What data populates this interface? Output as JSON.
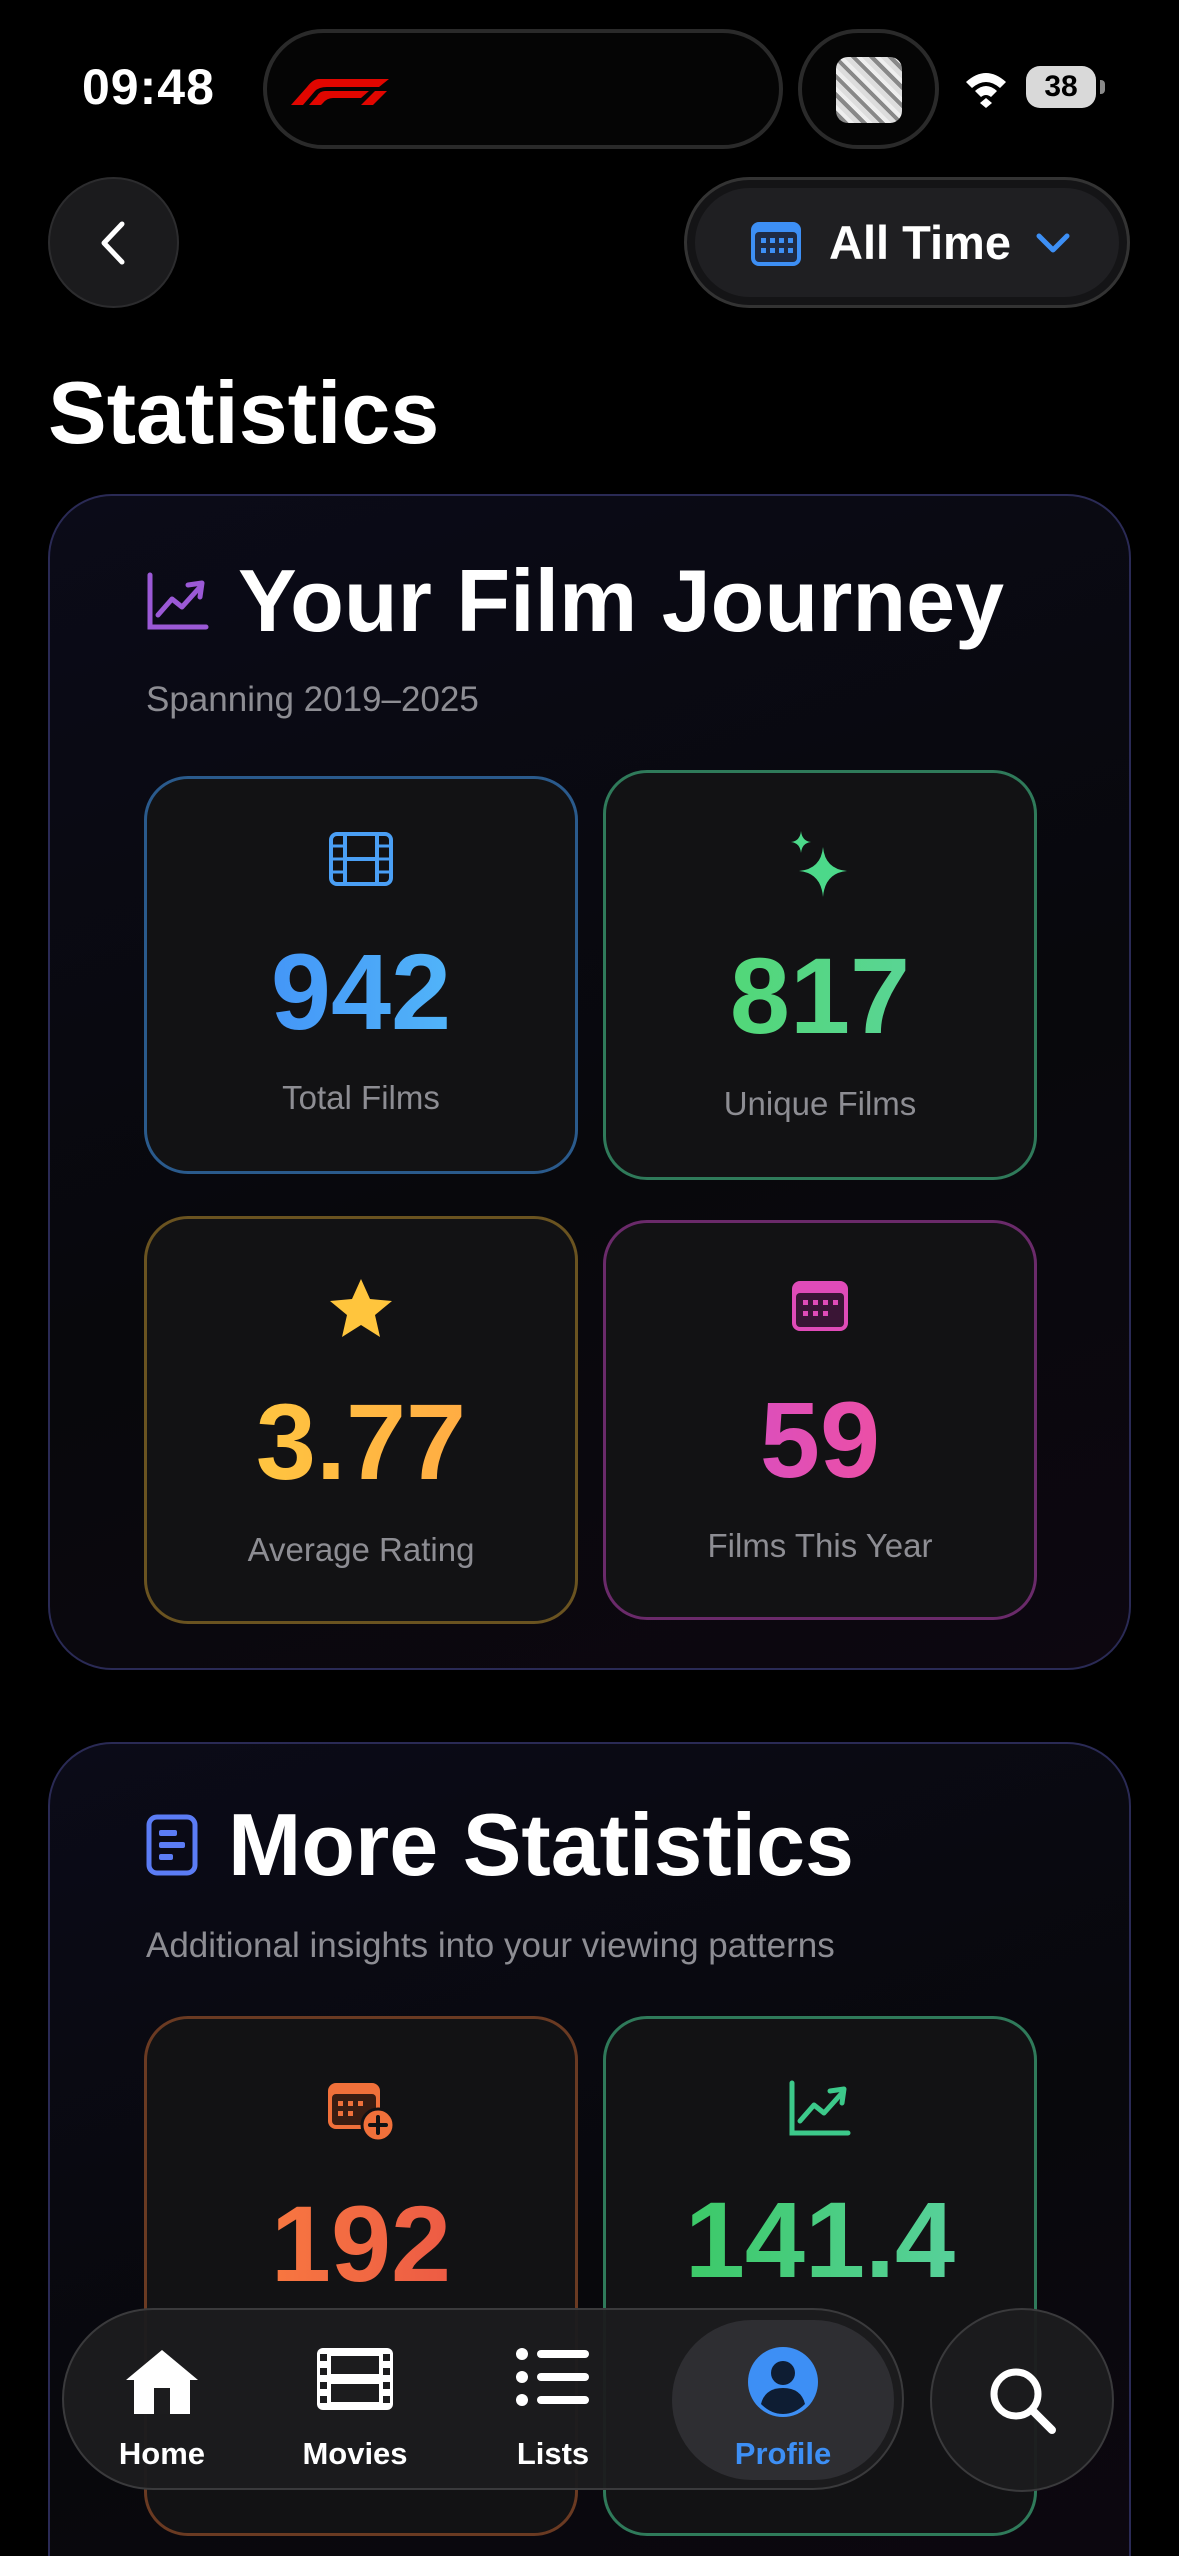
{
  "status_bar": {
    "time": "09:48",
    "battery": "38"
  },
  "header": {
    "filter_label": "All Time",
    "page_title": "Statistics"
  },
  "journey": {
    "title": "Your Film Journey",
    "subtitle": "Spanning 2019–2025",
    "stats": [
      {
        "value": "942",
        "label": "Total Films",
        "icon": "film-icon",
        "color_from": "#3b82f6",
        "color_to": "#5ac8fa"
      },
      {
        "value": "817",
        "label": "Unique Films",
        "icon": "sparkles-icon",
        "color_from": "#4cd964",
        "color_to": "#5fd3a8"
      },
      {
        "value": "3.77",
        "label": "Average Rating",
        "icon": "star-icon",
        "color_from": "#ffd23f",
        "color_to": "#ff9f45"
      },
      {
        "value": "59",
        "label": "Films This Year",
        "icon": "calendar-icon",
        "color_from": "#c94fd6",
        "color_to": "#ff4f8b"
      }
    ]
  },
  "more": {
    "title": "More Statistics",
    "subtitle": "Additional insights into your viewing patterns",
    "stats": [
      {
        "value": "192",
        "icon": "calendar-plus-icon",
        "color_from": "#ff8a3d",
        "color_to": "#e54848"
      },
      {
        "value": "141.4",
        "icon": "trend-icon",
        "color_from": "#34c759",
        "color_to": "#5fd3a8"
      }
    ]
  },
  "tabbar": {
    "tabs": [
      {
        "label": "Home",
        "icon": "house-icon"
      },
      {
        "label": "Movies",
        "icon": "film-strip-icon"
      },
      {
        "label": "Lists",
        "icon": "list-icon"
      },
      {
        "label": "Profile",
        "icon": "person-icon",
        "active": true
      }
    ]
  },
  "colors": {
    "accent": "#3d8ff5",
    "background": "#000000"
  }
}
